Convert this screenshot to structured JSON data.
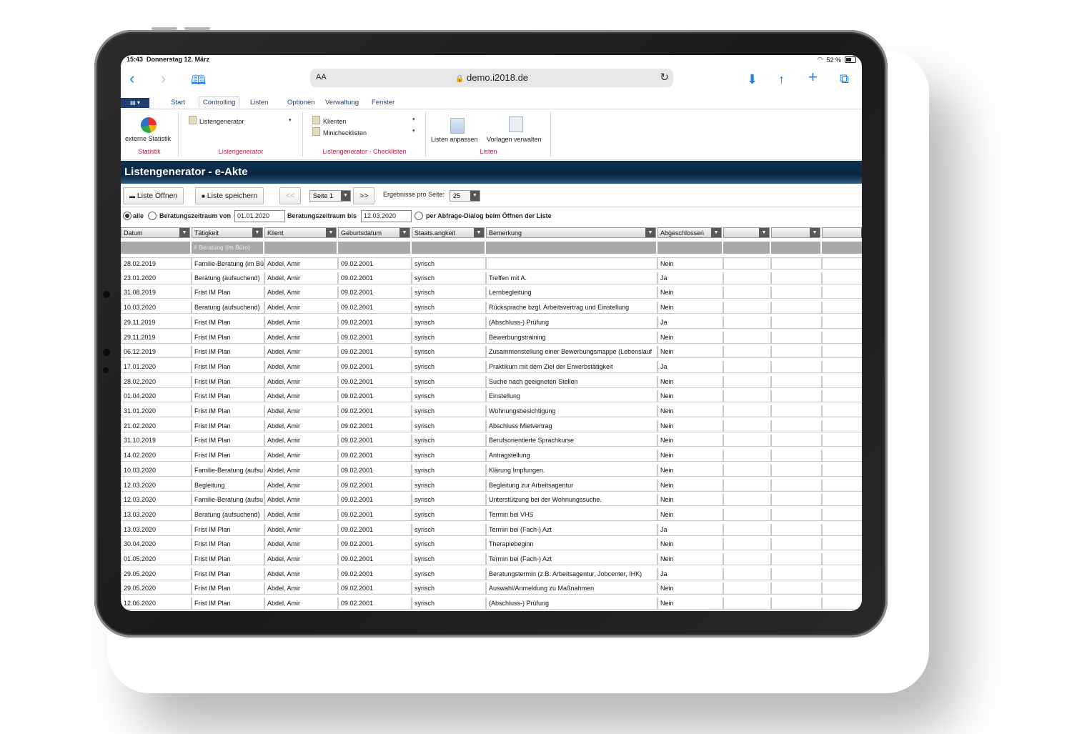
{
  "status": {
    "time": "15:43",
    "date": "Donnerstag 12. März",
    "battery": "52 %"
  },
  "browser": {
    "text_size_label": "AA",
    "url": "demo.i2018.de"
  },
  "menu": {
    "items": [
      "Start",
      "Controlling",
      "Listen",
      "Optionen",
      "Verwaltung",
      "Fenster"
    ],
    "active": "Controlling"
  },
  "ribbon": {
    "statistik": {
      "button": "externe Statistik",
      "group": "Statistik"
    },
    "listengenerator": {
      "item": "Listengenerator",
      "group": "Listengenerator"
    },
    "checklisten": {
      "items": [
        "Klienten",
        "Minichecklisten"
      ],
      "group": "Listengenerator - Checklisten"
    },
    "listen": {
      "buttons": [
        "Listen anpassen",
        "Vorlagen verwalten"
      ],
      "group": "Listen"
    }
  },
  "title": "Listengenerator - e-Akte",
  "toolbar": {
    "open_label": "Liste Öffnen",
    "save_label": "Liste speichern",
    "prev_label": "<<",
    "page_value": "Seite 1",
    "next_label": ">>",
    "per_page_label": "Ergebnisse pro Seite:",
    "per_page_value": "25"
  },
  "filter": {
    "all_label": "alle",
    "from_label": "Beratungszeitraum von",
    "from_value": "01.01.2020",
    "to_label": "Beratungszeitraum bis",
    "to_value": "12.03.2020",
    "dialog_label": "per Abfrage-Dialog beim Öffnen der Liste"
  },
  "table": {
    "columns": [
      "Datum",
      "Tätigkeit",
      "Klient",
      "Geburtsdatum",
      "Staats.angkeit",
      "Bemerkung",
      "Abgeschlossen",
      "",
      "",
      ""
    ],
    "filters": [
      "",
      "# Beratung (im Büro)",
      "",
      "",
      "",
      "",
      "",
      "",
      "",
      ""
    ],
    "rows": [
      [
        "28.02.2019",
        "Familie-Beratung (im Bü",
        "Abdel, Amir",
        "09.02.2001",
        "syrisch",
        "",
        "Nein"
      ],
      [
        "23.01.2020",
        "Beratung (aufsuchend)",
        "Abdel, Amir",
        "09.02.2001",
        "syrisch",
        "Treffen mit A.",
        "Ja"
      ],
      [
        "31.08.2019",
        "Frist IM Plan",
        "Abdel, Amir",
        "09.02.2001",
        "syrisch",
        "Lernbegleitung",
        "Nein"
      ],
      [
        "10.03.2020",
        "Beratung (aufsuchend)",
        "Abdel, Amir",
        "09.02.2001",
        "syrisch",
        "Rücksprache bzgl. Arbeitsvertrag und Einstellung",
        "Nein"
      ],
      [
        "29.11.2019",
        "Frist IM Plan",
        "Abdel, Amir",
        "09.02.2001",
        "syrisch",
        "(Abschluss-) Prüfung",
        "Ja"
      ],
      [
        "29.11.2019",
        "Frist IM Plan",
        "Abdel, Amir",
        "09.02.2001",
        "syrisch",
        "Bewerbungstraining",
        "Nein"
      ],
      [
        "06.12.2019",
        "Frist IM Plan",
        "Abdel, Amir",
        "09.02.2001",
        "syrisch",
        "Zusammenstellung einer Bewerbungsmappe (Lebenslauf",
        "Nein"
      ],
      [
        "17.01.2020",
        "Frist IM Plan",
        "Abdel, Amir",
        "09.02.2001",
        "syrisch",
        "Praktikum mit dem Ziel der Erwerbstätigkeit",
        "Ja"
      ],
      [
        "28.02.2020",
        "Frist IM Plan",
        "Abdel, Amir",
        "09.02.2001",
        "syrisch",
        "Suche nach geeigneten Stellen",
        "Nein"
      ],
      [
        "01.04.2020",
        "Frist IM Plan",
        "Abdel, Amir",
        "09.02.2001",
        "syrisch",
        "Einstellung",
        "Nein"
      ],
      [
        "31.01.2020",
        "Frist IM Plan",
        "Abdel, Amir",
        "09.02.2001",
        "syrisch",
        "Wohnungsbesichtigung",
        "Nein"
      ],
      [
        "21.02.2020",
        "Frist IM Plan",
        "Abdel, Amir",
        "09.02.2001",
        "syrisch",
        "Abschluss Mietvertrag",
        "Nein"
      ],
      [
        "31.10.2019",
        "Frist IM Plan",
        "Abdel, Amir",
        "09.02.2001",
        "syrisch",
        "Berufsorientierte Sprachkurse",
        "Nein"
      ],
      [
        "14.02.2020",
        "Frist IM Plan",
        "Abdel, Amir",
        "09.02.2001",
        "syrisch",
        "Antragstellung",
        "Nein"
      ],
      [
        "10.03.2020",
        "Familie-Beratung (aufsu",
        "Abdel, Amir",
        "09.02.2001",
        "syrisch",
        "Klärung Impfungen.",
        "Nein"
      ],
      [
        "12.03.2020",
        "Begleitung",
        "Abdel, Amir",
        "09.02.2001",
        "syrisch",
        "Begleitung zur Arbeitsagentur",
        "Nein"
      ],
      [
        "12.03.2020",
        "Familie-Beratung (aufsu",
        "Abdel, Amir",
        "09.02.2001",
        "syrisch",
        "Unterstützung bei der Wohnungssuche.",
        "Nein"
      ],
      [
        "13.03.2020",
        "Beratung (aufsuchend)",
        "Abdel, Amir",
        "09.02.2001",
        "syrisch",
        "Termin bei VHS",
        "Nein"
      ],
      [
        "13.03.2020",
        "Frist IM Plan",
        "Abdel, Amir",
        "09.02.2001",
        "syrisch",
        "Termin bei (Fach-) Azt",
        "Ja"
      ],
      [
        "30.04.2020",
        "Frist IM Plan",
        "Abdel, Amir",
        "09.02.2001",
        "syrisch",
        "Therapiebeginn",
        "Nein"
      ],
      [
        "01.05.2020",
        "Frist IM Plan",
        "Abdel, Amir",
        "09.02.2001",
        "syrisch",
        "Termin bei (Fach-) Azt",
        "Nein"
      ],
      [
        "29.05.2020",
        "Frist IM Plan",
        "Abdel, Amir",
        "09.02.2001",
        "syrisch",
        "Beratungstermin (z.B. Arbeitsagentur, Jobcenter, IHK)",
        "Ja"
      ],
      [
        "29.05.2020",
        "Frist IM Plan",
        "Abdel, Amir",
        "09.02.2001",
        "syrisch",
        "Auswahl/Anmeldung zu Maßnahmen",
        "Nein"
      ],
      [
        "12.06.2020",
        "Frist IM Plan",
        "Abdel, Amir",
        "09.02.2001",
        "syrisch",
        "(Abschluss-) Prüfung",
        "Nein"
      ]
    ]
  },
  "colors": {
    "titlebar": "#0c3252",
    "accent_link": "#1a7ef2",
    "group_label": "#c0264a"
  },
  "icons": [
    "back-icon",
    "forward-icon",
    "bookmarks-icon",
    "download-icon",
    "share-icon",
    "new-tab-icon",
    "tabs-icon",
    "reload-icon",
    "lock-icon",
    "wifi-icon",
    "battery-icon"
  ]
}
